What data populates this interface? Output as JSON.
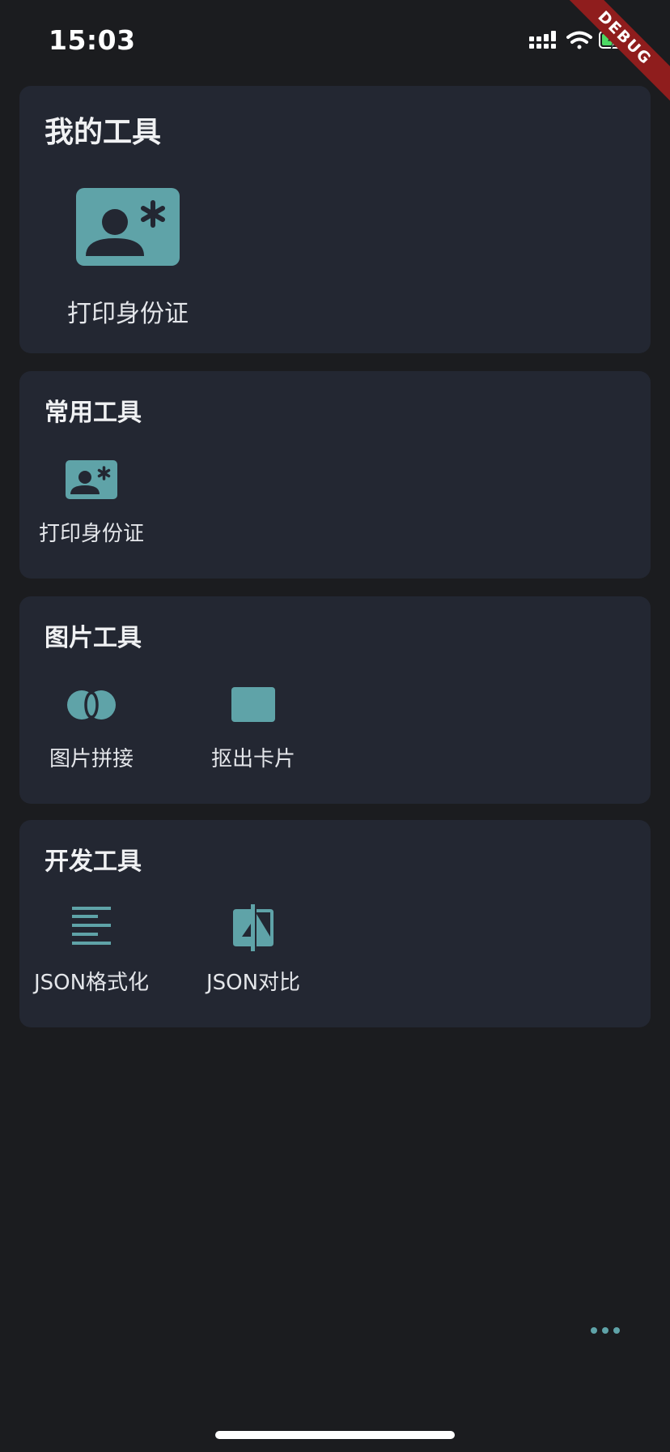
{
  "status_bar": {
    "time": "15:03",
    "icons": [
      "cellular-signal-icon",
      "wifi-icon",
      "battery-charging-icon"
    ],
    "debug_banner": "DEBUG",
    "debug_color": "#8f1d1d",
    "battery_color": "#4cd964"
  },
  "colors": {
    "background": "#1b1c1f",
    "card": "#232732",
    "accent": "#5fa3a8"
  },
  "sections": [
    {
      "title": "我的工具",
      "tools": [
        {
          "label": "打印身份证",
          "icon": "id-card-icon"
        }
      ]
    },
    {
      "title": "常用工具",
      "tools": [
        {
          "label": "打印身份证",
          "icon": "id-card-icon"
        }
      ]
    },
    {
      "title": "图片工具",
      "tools": [
        {
          "label": "图片拼接",
          "icon": "image-merge-icon"
        },
        {
          "label": "抠出卡片",
          "icon": "card-crop-icon"
        }
      ]
    },
    {
      "title": "开发工具",
      "tools": [
        {
          "label": "JSON格式化",
          "icon": "format-align-icon"
        },
        {
          "label": "JSON对比",
          "icon": "compare-icon"
        }
      ]
    }
  ],
  "fab": {
    "icon": "more-horizontal-icon"
  }
}
